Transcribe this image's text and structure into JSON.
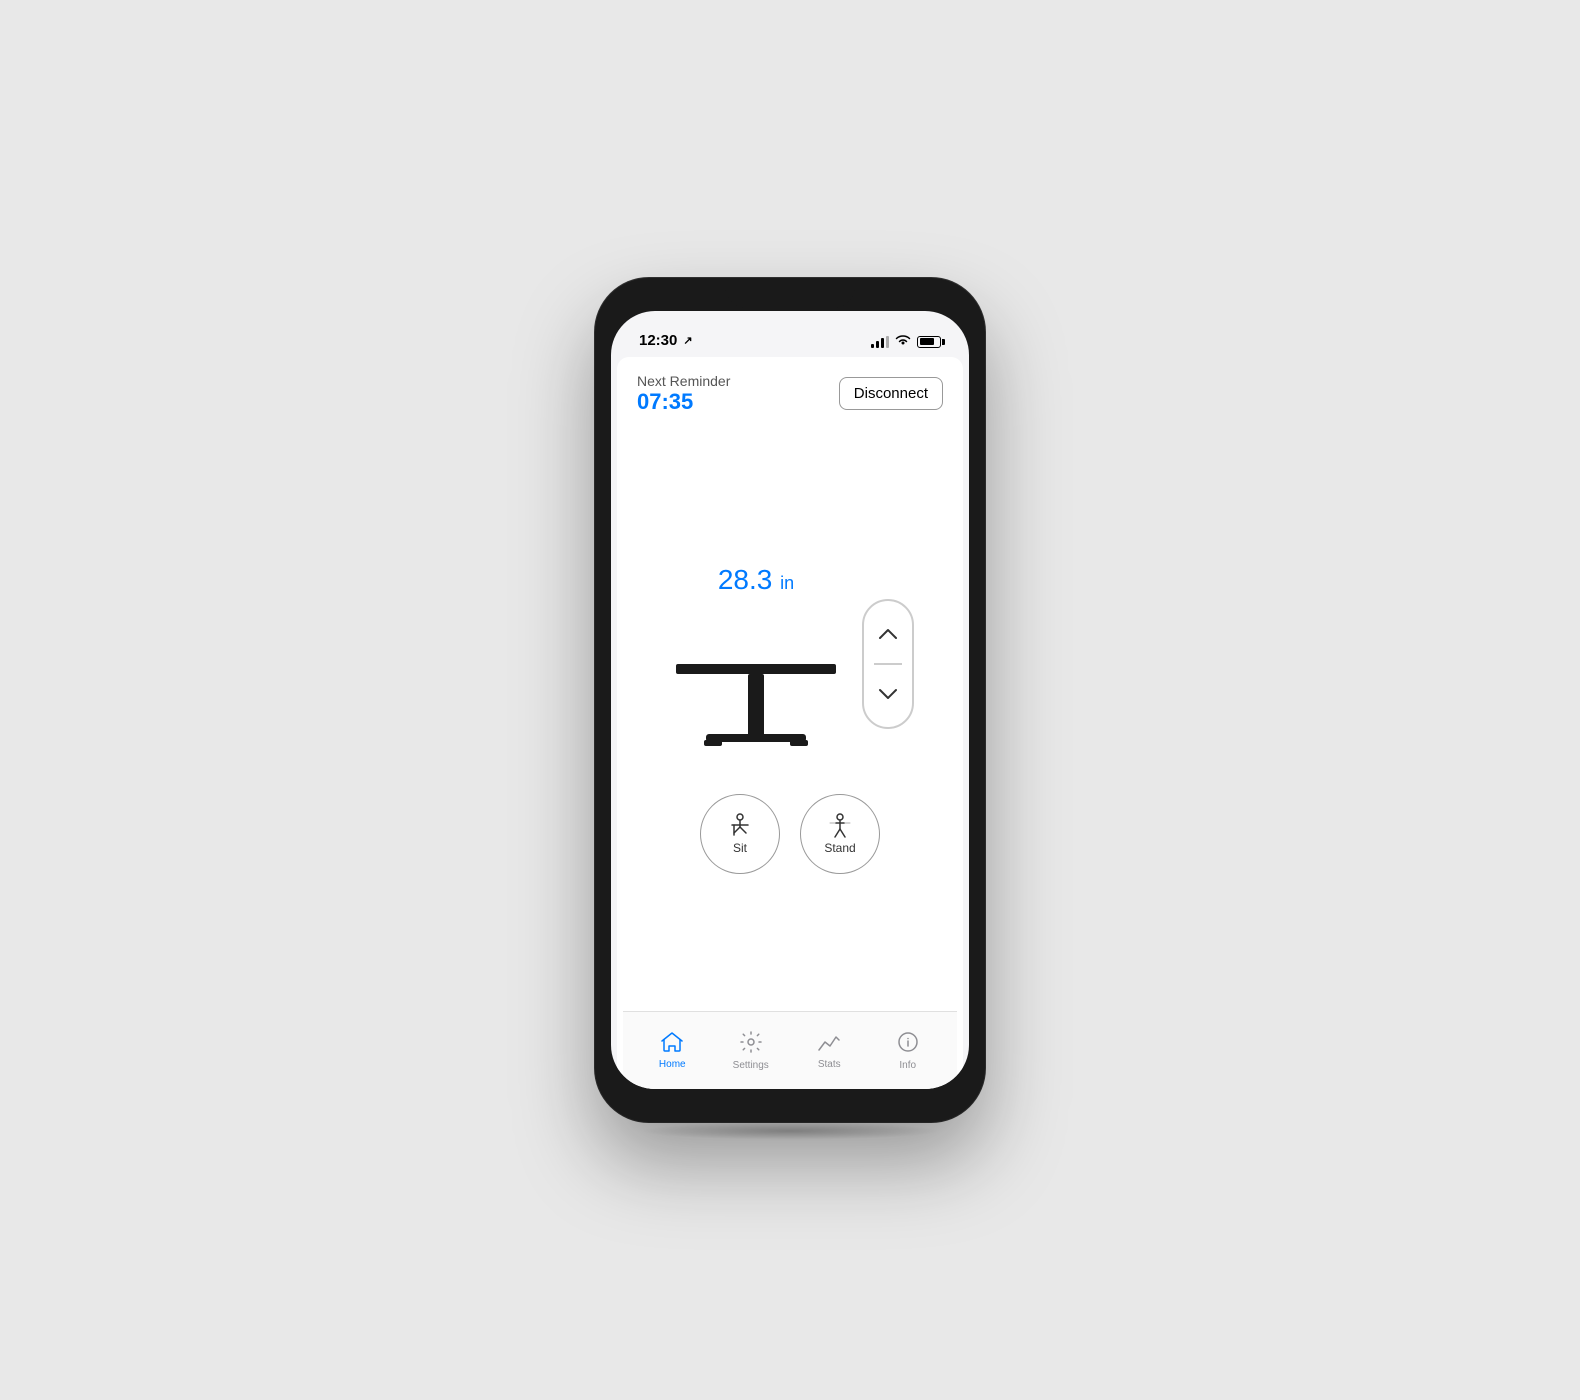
{
  "status_bar": {
    "time": "12:30",
    "location_arrow": "↗"
  },
  "header": {
    "reminder_label": "Next Reminder",
    "reminder_time": "07:35",
    "disconnect_button": "Disconnect"
  },
  "desk": {
    "height_value": "28.3",
    "height_unit": "in"
  },
  "controls": {
    "sit_label": "Sit",
    "stand_label": "Stand"
  },
  "tab_bar": {
    "tabs": [
      {
        "id": "home",
        "label": "Home",
        "active": true
      },
      {
        "id": "settings",
        "label": "Settings",
        "active": false
      },
      {
        "id": "stats",
        "label": "Stats",
        "active": false
      },
      {
        "id": "info",
        "label": "Info",
        "active": false
      }
    ]
  }
}
